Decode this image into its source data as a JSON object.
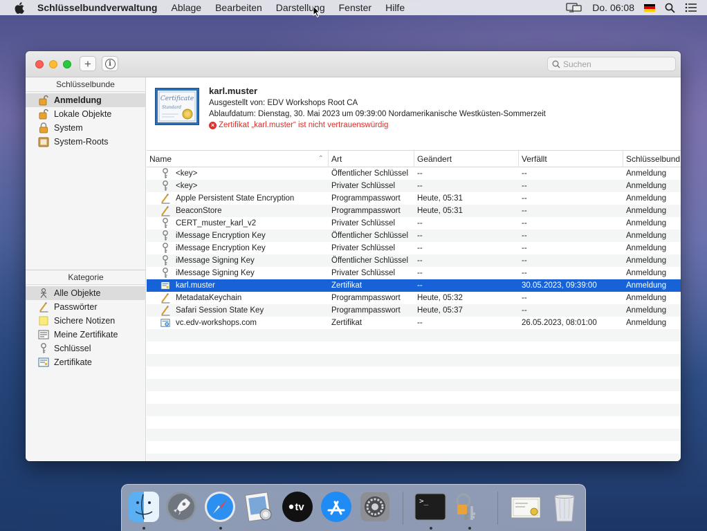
{
  "menubar": {
    "app_name": "Schlüsselbundverwaltung",
    "menus": [
      "Ablage",
      "Bearbeiten",
      "Darstellung",
      "Fenster",
      "Hilfe"
    ],
    "clock": "Do. 06:08"
  },
  "toolbar": {
    "add_label": "+",
    "info_label": "i",
    "search_placeholder": "Suchen"
  },
  "sidebar": {
    "keychains_header": "Schlüsselbunde",
    "keychains": [
      {
        "label": "Anmeldung",
        "icon": "unlocked-padlock-icon",
        "selected": true
      },
      {
        "label": "Lokale Objekte",
        "icon": "unlocked-padlock-icon"
      },
      {
        "label": "System",
        "icon": "locked-padlock-icon"
      },
      {
        "label": "System-Roots",
        "icon": "cabinet-icon"
      }
    ],
    "category_header": "Kategorie",
    "categories": [
      {
        "label": "Alle Objekte",
        "icon": "all-items-icon",
        "selected": true
      },
      {
        "label": "Passwörter",
        "icon": "password-icon"
      },
      {
        "label": "Sichere Notizen",
        "icon": "note-icon"
      },
      {
        "label": "Meine Zertifikate",
        "icon": "my-certificate-icon"
      },
      {
        "label": "Schlüssel",
        "icon": "key-icon"
      },
      {
        "label": "Zertifikate",
        "icon": "certificate-icon"
      }
    ]
  },
  "detail": {
    "name": "karl.muster",
    "issuer": "Ausgestellt von: EDV Workshops Root CA",
    "expiry": "Ablaufdatum: Dienstag, 30. Mai 2023 um 09:39:00 Nordamerikanische Westküsten-Sommerzeit",
    "warning": "Zertifikat „karl.muster“ ist nicht vertrauenswürdig",
    "cert_image_text_1": "Certificate",
    "cert_image_text_2": "Standard"
  },
  "table": {
    "columns": [
      "Name",
      "Art",
      "Geändert",
      "Verfällt",
      "Schlüsselbund"
    ],
    "rows": [
      {
        "name": "<key>",
        "type": "Öffentlicher Schlüssel",
        "changed": "--",
        "expires": "--",
        "keychain": "Anmeldung",
        "icon": "key"
      },
      {
        "name": "<key>",
        "type": "Privater Schlüssel",
        "changed": "--",
        "expires": "--",
        "keychain": "Anmeldung",
        "icon": "key"
      },
      {
        "name": "Apple Persistent State Encryption",
        "type": "Programmpasswort",
        "changed": "Heute, 05:31",
        "expires": "--",
        "keychain": "Anmeldung",
        "icon": "password"
      },
      {
        "name": "BeaconStore",
        "type": "Programmpasswort",
        "changed": "Heute, 05:31",
        "expires": "--",
        "keychain": "Anmeldung",
        "icon": "password"
      },
      {
        "name": "CERT_muster_karl_v2",
        "type": "Privater Schlüssel",
        "changed": "--",
        "expires": "--",
        "keychain": "Anmeldung",
        "icon": "key"
      },
      {
        "name": "iMessage Encryption Key",
        "type": "Öffentlicher Schlüssel",
        "changed": "--",
        "expires": "--",
        "keychain": "Anmeldung",
        "icon": "key"
      },
      {
        "name": "iMessage Encryption Key",
        "type": "Privater Schlüssel",
        "changed": "--",
        "expires": "--",
        "keychain": "Anmeldung",
        "icon": "key"
      },
      {
        "name": "iMessage Signing Key",
        "type": "Öffentlicher Schlüssel",
        "changed": "--",
        "expires": "--",
        "keychain": "Anmeldung",
        "icon": "key"
      },
      {
        "name": "iMessage Signing Key",
        "type": "Privater Schlüssel",
        "changed": "--",
        "expires": "--",
        "keychain": "Anmeldung",
        "icon": "key"
      },
      {
        "name": "karl.muster",
        "type": "Zertifikat",
        "changed": "--",
        "expires": "30.05.2023, 09:39:00",
        "keychain": "Anmeldung",
        "icon": "certificate",
        "selected": true
      },
      {
        "name": "MetadataKeychain",
        "type": "Programmpasswort",
        "changed": "Heute, 05:32",
        "expires": "--",
        "keychain": "Anmeldung",
        "icon": "password"
      },
      {
        "name": "Safari Session State Key",
        "type": "Programmpasswort",
        "changed": "Heute, 05:37",
        "expires": "--",
        "keychain": "Anmeldung",
        "icon": "password"
      },
      {
        "name": "vc.edv-workshops.com",
        "type": "Zertifikat",
        "changed": "--",
        "expires": "26.05.2023, 08:01:00",
        "keychain": "Anmeldung",
        "icon": "certificate-plus"
      }
    ]
  },
  "dock": {
    "apps": [
      {
        "name": "finder-icon"
      },
      {
        "name": "launchpad-icon"
      },
      {
        "name": "safari-icon"
      },
      {
        "name": "preview-icon"
      },
      {
        "name": "apple-tv-icon",
        "label": "tv"
      },
      {
        "name": "app-store-icon"
      },
      {
        "name": "system-preferences-icon"
      },
      {
        "name": "terminal-icon",
        "label": ">_"
      },
      {
        "name": "keychain-access-icon"
      },
      {
        "name": "certificate-document-icon"
      },
      {
        "name": "trash-icon"
      }
    ]
  },
  "colors": {
    "selection": "#1662d6",
    "warning": "#d9302a",
    "close": "#fe5f57",
    "minimize": "#febc2e",
    "maximize": "#28c840"
  }
}
